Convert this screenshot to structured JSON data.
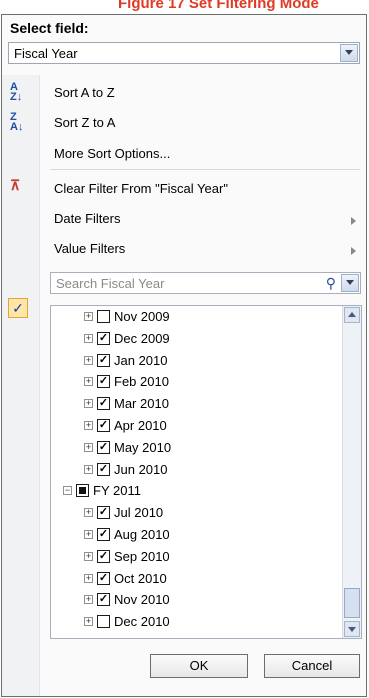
{
  "caption": "Figure 17 Set Filtering Mode",
  "field_header": "Select field:",
  "field_select": {
    "value": "Fiscal Year"
  },
  "menu": {
    "sort_az": "Sort A to Z",
    "sort_za": "Sort Z to A",
    "more_sort": "More Sort Options...",
    "clear_filter": "Clear Filter From \"Fiscal Year\"",
    "date_filters": "Date Filters",
    "value_filters": "Value Filters"
  },
  "search": {
    "placeholder": "Search Fiscal Year"
  },
  "tree_items": [
    {
      "label": "Nov 2009",
      "checked": false
    },
    {
      "label": "Dec 2009",
      "checked": true
    },
    {
      "label": "Jan 2010",
      "checked": true
    },
    {
      "label": "Feb 2010",
      "checked": true
    },
    {
      "label": "Mar 2010",
      "checked": true
    },
    {
      "label": "Apr 2010",
      "checked": true
    },
    {
      "label": "May 2010",
      "checked": true
    },
    {
      "label": "Jun 2010",
      "checked": true
    },
    {
      "label": "FY 2011",
      "checked": "partial",
      "parent": true
    },
    {
      "label": "Jul 2010",
      "checked": true
    },
    {
      "label": "Aug 2010",
      "checked": true
    },
    {
      "label": "Sep 2010",
      "checked": true
    },
    {
      "label": "Oct 2010",
      "checked": true
    },
    {
      "label": "Nov 2010",
      "checked": true
    },
    {
      "label": "Dec 2010",
      "checked": false
    }
  ],
  "buttons": {
    "ok": "OK",
    "cancel": "Cancel"
  },
  "colors": {
    "caption": "#e03a24",
    "accent": "#1f4fa0"
  }
}
